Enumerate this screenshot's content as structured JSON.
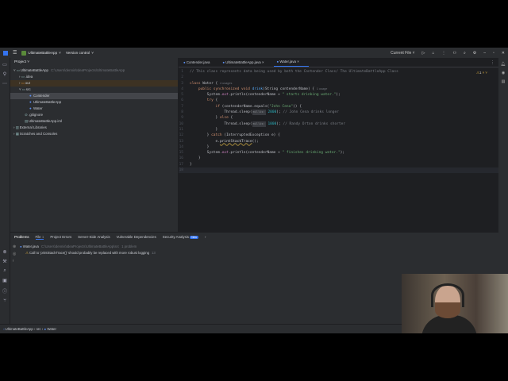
{
  "titlebar": {
    "project": "UltimateBattleApp",
    "project_initials": "UA",
    "vcs": "Version control",
    "run_config": "Current File"
  },
  "project_panel": {
    "title": "Project",
    "root": "UltimateBattleApp",
    "root_path": "C:\\Users\\dennis\\IdeaProjects\\UltimateBattleApp",
    "items": [
      {
        "label": ".idea",
        "kind": "folder"
      },
      {
        "label": "out",
        "kind": "folder"
      },
      {
        "label": "src",
        "kind": "folder"
      },
      {
        "label": "Contender",
        "kind": "class"
      },
      {
        "label": "UltimateBattleApp",
        "kind": "class"
      },
      {
        "label": "Water",
        "kind": "class"
      },
      {
        "label": ".gitignore",
        "kind": "file"
      },
      {
        "label": "UltimateBattleApp.iml",
        "kind": "file"
      },
      {
        "label": "External Libraries",
        "kind": "lib"
      },
      {
        "label": "Scratches and Consoles",
        "kind": "scratch"
      }
    ]
  },
  "editor": {
    "tabs": [
      {
        "label": "Contender.java"
      },
      {
        "label": "UltimateBattleApp.java"
      },
      {
        "label": "Water.java"
      }
    ],
    "warnings": "1",
    "lines": [
      [
        {
          "c": "cm",
          "t": "// This class represents data being used by both the Contender Class/ The UltimateBattleApp Class"
        }
      ],
      [],
      [
        {
          "c": "kw",
          "t": "class "
        },
        {
          "c": "pl",
          "t": "Water { "
        },
        {
          "c": "hint",
          "t": "4 usages"
        }
      ],
      [
        {
          "c": "kw",
          "t": "    public synchronized void "
        },
        {
          "c": "fn",
          "t": "drink"
        },
        {
          "c": "pl",
          "t": "(String contenderName) { "
        },
        {
          "c": "hint",
          "t": "1 usage"
        }
      ],
      [
        {
          "c": "pl",
          "t": "        System."
        },
        {
          "c": "st",
          "t": "out"
        },
        {
          "c": "pl",
          "t": ".println(contenderName + "
        },
        {
          "c": "str",
          "t": "\" starts drinking water.\""
        },
        {
          "c": "pl",
          "t": ");"
        }
      ],
      [
        {
          "c": "kw",
          "t": "        try "
        },
        {
          "c": "pl",
          "t": "{"
        }
      ],
      [
        {
          "c": "kw",
          "t": "            if "
        },
        {
          "c": "pl",
          "t": "(contenderName.equals("
        },
        {
          "c": "str",
          "t": "\"John Cena\""
        },
        {
          "c": "pl",
          "t": ")) {"
        }
      ],
      [
        {
          "c": "pl",
          "t": "                Thread.sleep("
        },
        {
          "c": "inl",
          "t": "millis:"
        },
        {
          "c": "num",
          "t": " 2000"
        },
        {
          "c": "pl",
          "t": "); "
        },
        {
          "c": "cm",
          "t": "// John Cena drinks longer"
        }
      ],
      [
        {
          "c": "pl",
          "t": "            } "
        },
        {
          "c": "kw",
          "t": "else "
        },
        {
          "c": "pl",
          "t": "{"
        }
      ],
      [
        {
          "c": "pl",
          "t": "                Thread.sleep("
        },
        {
          "c": "inl",
          "t": "millis:"
        },
        {
          "c": "num",
          "t": " 1000"
        },
        {
          "c": "pl",
          "t": "); "
        },
        {
          "c": "cm",
          "t": "// Randy Orton drinks shorter"
        }
      ],
      [
        {
          "c": "pl",
          "t": "            }"
        }
      ],
      [
        {
          "c": "pl",
          "t": "        } "
        },
        {
          "c": "kw",
          "t": "catch "
        },
        {
          "c": "pl",
          "t": "(InterruptedException e) {"
        }
      ],
      [
        {
          "c": "pl",
          "t": "            e."
        },
        {
          "c": "warn",
          "t": "printStackTrace"
        },
        {
          "c": "pl",
          "t": "();"
        }
      ],
      [
        {
          "c": "pl",
          "t": "        }"
        }
      ],
      [
        {
          "c": "pl",
          "t": "        System."
        },
        {
          "c": "st",
          "t": "out"
        },
        {
          "c": "pl",
          "t": ".println(contenderName + "
        },
        {
          "c": "str",
          "t": "\" finishes drinking water.\""
        },
        {
          "c": "pl",
          "t": ");"
        }
      ],
      [
        {
          "c": "pl",
          "t": "    }"
        }
      ],
      [
        {
          "c": "pl",
          "t": "}"
        }
      ],
      []
    ]
  },
  "problems": {
    "tabs": [
      {
        "label": "Problems"
      },
      {
        "label": "File",
        "count": "1"
      },
      {
        "label": "Project Errors"
      },
      {
        "label": "Server-Side Analysis"
      },
      {
        "label": "Vulnerable Dependencies"
      },
      {
        "label": "Security Analysis",
        "badge": "New"
      }
    ],
    "file": "Water.java",
    "file_path": "C:\\Users\\dennis\\IdeaProjects\\UltimateBattleApp\\src",
    "file_count": "1 problem",
    "message": "Call to 'printStackTrace()' should probably be replaced with more robust logging",
    "message_line": "13"
  },
  "statusbar": {
    "crumbs": [
      "UltimateBattleApp",
      "src",
      "Water"
    ]
  }
}
